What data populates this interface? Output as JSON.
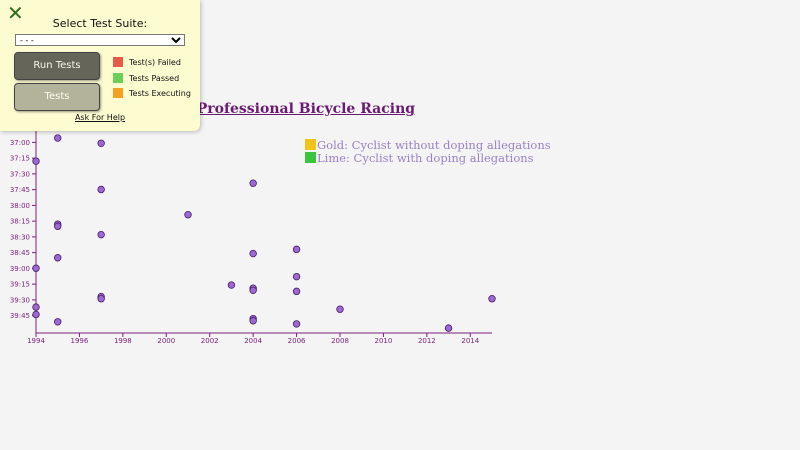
{
  "panel": {
    "close_glyph": "✕",
    "suite_label": "Select Test Suite:",
    "suite_selected": "- - -",
    "run_button": "Run Tests",
    "tests_button": "Tests",
    "status": [
      {
        "label": "Test(s) Failed",
        "color": "#e8594a"
      },
      {
        "label": "Tests Passed",
        "color": "#6ad05a"
      },
      {
        "label": "Tests Executing",
        "color": "#f5a020"
      }
    ],
    "help_link": "Ask For Help"
  },
  "chart_data": {
    "type": "scatter",
    "title": "Doping in Professional Bicycle Racing",
    "legend": [
      {
        "label": "Gold: Cyclist without doping allegations",
        "color": "#f2c418"
      },
      {
        "label": "Lime: Cyclist with doping allegations",
        "color": "#3cc43c"
      }
    ],
    "legend_position": "top-right",
    "xlim": [
      1994,
      2015
    ],
    "x_ticks": [
      1994,
      1996,
      1998,
      2000,
      2002,
      2004,
      2006,
      2008,
      2010,
      2012,
      2014
    ],
    "y_ticks": [
      "37:00",
      "37:15",
      "37:30",
      "37:45",
      "38:00",
      "38:15",
      "38:30",
      "38:45",
      "39:00",
      "39:15",
      "39:30",
      "39:45"
    ],
    "ylim_seconds": [
      2210,
      2395
    ],
    "y_unit": "seconds",
    "grid": false,
    "point_color": "#9a6ad0",
    "points": [
      {
        "x": 1995,
        "y": 2213
      },
      {
        "x": 1997,
        "y": 2218
      },
      {
        "x": 1994,
        "y": 2235
      },
      {
        "x": 2004,
        "y": 2256
      },
      {
        "x": 1997,
        "y": 2262
      },
      {
        "x": 2001,
        "y": 2286
      },
      {
        "x": 1995,
        "y": 2295
      },
      {
        "x": 1995,
        "y": 2297
      },
      {
        "x": 1997,
        "y": 2305
      },
      {
        "x": 2004,
        "y": 2323
      },
      {
        "x": 2006,
        "y": 2319
      },
      {
        "x": 1995,
        "y": 2327
      },
      {
        "x": 1994,
        "y": 2337
      },
      {
        "x": 2006,
        "y": 2345
      },
      {
        "x": 2003,
        "y": 2353
      },
      {
        "x": 2004,
        "y": 2356
      },
      {
        "x": 2004,
        "y": 2358
      },
      {
        "x": 2006,
        "y": 2359
      },
      {
        "x": 1997,
        "y": 2364
      },
      {
        "x": 1997,
        "y": 2366
      },
      {
        "x": 2015,
        "y": 2366
      },
      {
        "x": 1994,
        "y": 2374
      },
      {
        "x": 2008,
        "y": 2376
      },
      {
        "x": 1994,
        "y": 2381
      },
      {
        "x": 2004,
        "y": 2385
      },
      {
        "x": 2004,
        "y": 2387
      },
      {
        "x": 1995,
        "y": 2388
      },
      {
        "x": 2006,
        "y": 2390
      },
      {
        "x": 2013,
        "y": 2394
      }
    ]
  }
}
